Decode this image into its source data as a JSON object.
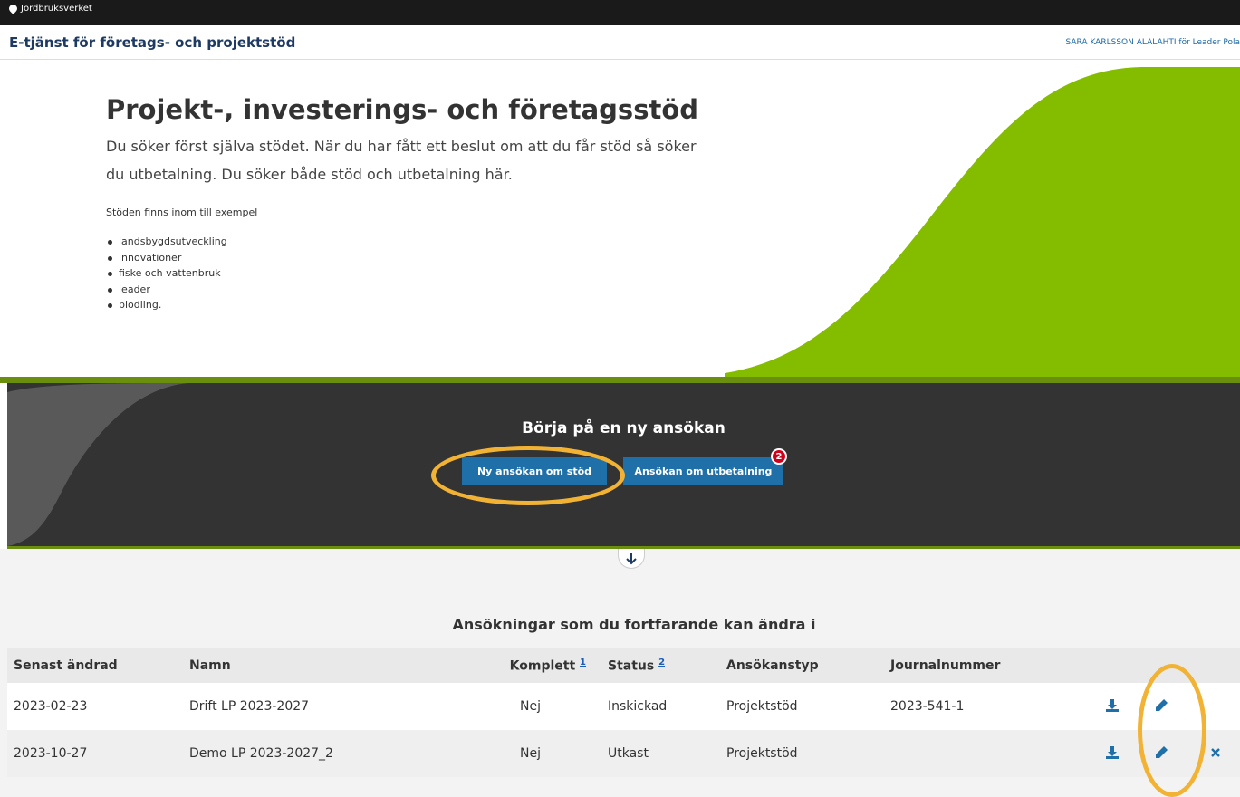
{
  "topbar": {
    "brand": "Jordbruksverket"
  },
  "header": {
    "service_title": "E-tjänst för företags- och projektstöd",
    "user": "SARA KARLSSON ALALAHTI för Leader Pola"
  },
  "hero": {
    "title": "Projekt-, investerings- och företagsstöd",
    "lead": "Du söker först själva stödet. När du har fått ett beslut om att du får stöd så söker du utbetalning. Du söker både stöd och utbetalning här.",
    "examples_label": "Stöden finns inom till exempel",
    "examples": [
      "landsbygdsutveckling",
      "innovationer",
      "fiske och vattenbruk",
      "leader",
      "biodling."
    ]
  },
  "cta": {
    "heading": "Börja på en ny ansökan",
    "new_application_label": "Ny ansökan om stöd",
    "payment_application_label": "Ansökan om utbetalning",
    "payment_badge_count": "2"
  },
  "applications": {
    "title": "Ansökningar som du fortfarande kan ändra i",
    "headers": {
      "modified": "Senast ändrad",
      "name": "Namn",
      "complete": "Komplett",
      "complete_note": "1",
      "status": "Status",
      "status_note": "2",
      "type": "Ansökanstyp",
      "journal": "Journalnummer"
    },
    "rows": [
      {
        "modified": "2023-02-23",
        "name": "Drift LP 2023-2027",
        "complete": "Nej",
        "status": "Inskickad",
        "type": "Projektstöd",
        "journal": "2023-541-1"
      },
      {
        "modified": "2023-10-27",
        "name": "Demo LP 2023-2027_2",
        "complete": "Nej",
        "status": "Utkast",
        "type": "Projektstöd",
        "journal": ""
      }
    ]
  },
  "colors": {
    "brand_green": "#84bd00",
    "button_blue": "#1f6fa8",
    "dark_band": "#333333",
    "annotation": "#f2b233",
    "badge_red": "#d0021b"
  }
}
